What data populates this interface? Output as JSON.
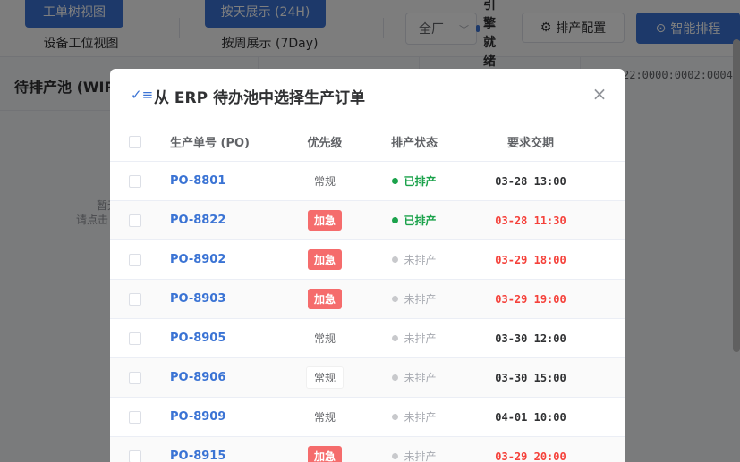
{
  "toolbar": {
    "tree_view": "工单树视图",
    "station_view": "设备工位视图",
    "day_view": "按天展示 (24H)",
    "week_view": "按周展示 (7Day)",
    "plant_select": "全厂",
    "engine_status": "引擎就绪",
    "config_button": "排产配置",
    "smart_button": "智能排程",
    "primary_color": "#3a73d4"
  },
  "wip": {
    "title": "待排产池 (WIP)",
    "empty_line1": "暂无",
    "empty_line2": "请点击"
  },
  "timeline_label": "22:0000:0002:0004",
  "dialog": {
    "title": "从 ERP 待办池中选择生产订单",
    "close_icon": "×",
    "columns": {
      "po": "生产单号 (PO)",
      "priority": "优先级",
      "status": "排产状态",
      "due": "要求交期"
    },
    "rows": [
      {
        "po": "PO-8801",
        "priority": "常规",
        "status": "已排产",
        "due": "03-28 13:00"
      },
      {
        "po": "PO-8822",
        "priority": "加急",
        "status": "已排产",
        "due": "03-28 11:30"
      },
      {
        "po": "PO-8902",
        "priority": "加急",
        "status": "未排产",
        "due": "03-29 18:00"
      },
      {
        "po": "PO-8903",
        "priority": "加急",
        "status": "未排产",
        "due": "03-29 19:00"
      },
      {
        "po": "PO-8905",
        "priority": "常规",
        "status": "未排产",
        "due": "03-30 12:00"
      },
      {
        "po": "PO-8906",
        "priority": "常规",
        "status": "未排产",
        "due": "03-30 15:00"
      },
      {
        "po": "PO-8909",
        "priority": "常规",
        "status": "未排产",
        "due": "04-01 10:00"
      },
      {
        "po": "PO-8915",
        "priority": "加急",
        "status": "未排产",
        "due": "03-29 20:00"
      }
    ]
  },
  "colors": {
    "urgent": "#f56c6c",
    "scheduled": "#1ba24b",
    "late_due": "#f5413a"
  }
}
